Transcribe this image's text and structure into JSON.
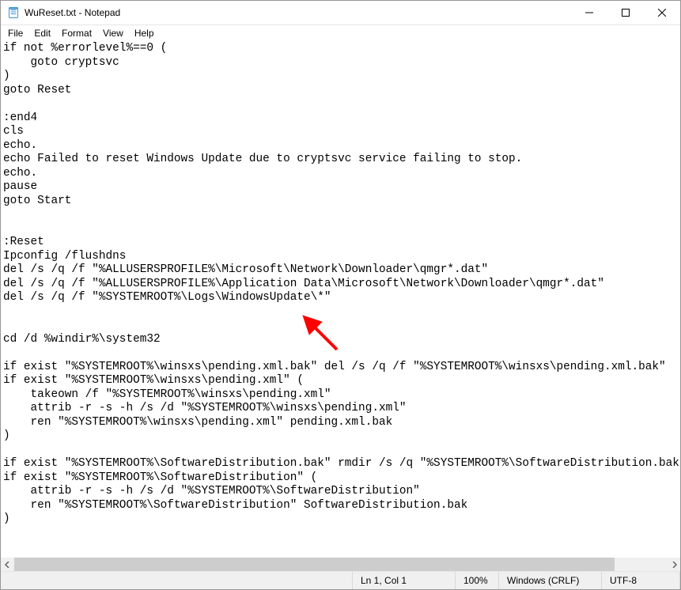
{
  "titlebar": {
    "title": "WuReset.txt - Notepad"
  },
  "menubar": {
    "file": "File",
    "edit": "Edit",
    "format": "Format",
    "view": "View",
    "help": "Help"
  },
  "editor": {
    "content": "if not %errorlevel%==0 (\n    goto cryptsvc\n)\ngoto Reset\n\n:end4\ncls\necho.\necho Failed to reset Windows Update due to cryptsvc service failing to stop.\necho.\npause\ngoto Start\n\n\n:Reset\nIpconfig /flushdns\ndel /s /q /f \"%ALLUSERSPROFILE%\\Microsoft\\Network\\Downloader\\qmgr*.dat\"\ndel /s /q /f \"%ALLUSERSPROFILE%\\Application Data\\Microsoft\\Network\\Downloader\\qmgr*.dat\"\ndel /s /q /f \"%SYSTEMROOT%\\Logs\\WindowsUpdate\\*\"\n\n\ncd /d %windir%\\system32\n\nif exist \"%SYSTEMROOT%\\winsxs\\pending.xml.bak\" del /s /q /f \"%SYSTEMROOT%\\winsxs\\pending.xml.bak\"\nif exist \"%SYSTEMROOT%\\winsxs\\pending.xml\" (\n    takeown /f \"%SYSTEMROOT%\\winsxs\\pending.xml\"\n    attrib -r -s -h /s /d \"%SYSTEMROOT%\\winsxs\\pending.xml\"\n    ren \"%SYSTEMROOT%\\winsxs\\pending.xml\" pending.xml.bak\n)\n\nif exist \"%SYSTEMROOT%\\SoftwareDistribution.bak\" rmdir /s /q \"%SYSTEMROOT%\\SoftwareDistribution.bak\"\nif exist \"%SYSTEMROOT%\\SoftwareDistribution\" (\n    attrib -r -s -h /s /d \"%SYSTEMROOT%\\SoftwareDistribution\"\n    ren \"%SYSTEMROOT%\\SoftwareDistribution\" SoftwareDistribution.bak\n)\n"
  },
  "statusbar": {
    "position": "Ln 1, Col 1",
    "zoom": "100%",
    "line_ending": "Windows (CRLF)",
    "encoding": "UTF-8"
  },
  "annotation": {
    "arrow_color": "#ff0000"
  }
}
